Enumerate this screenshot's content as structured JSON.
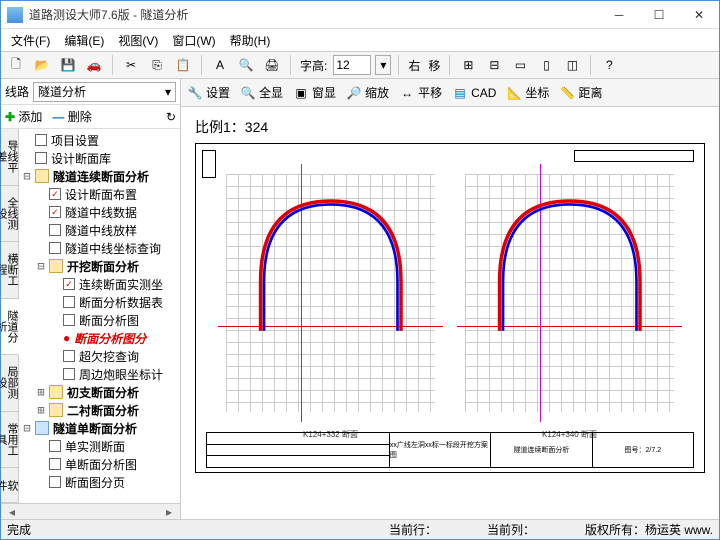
{
  "title": "道路测设大师7.6版 - 隧道分析",
  "menu": {
    "file": "文件(F)",
    "edit": "编辑(E)",
    "view": "视图(V)",
    "window": "窗口(W)",
    "help": "帮助(H)"
  },
  "tb1": {
    "fh_label": "字高:",
    "fh_value": "12",
    "right": "右",
    "move": "移"
  },
  "route": {
    "label": "线路",
    "value": "隧道分析"
  },
  "ops": {
    "add": "添加",
    "del": "删除"
  },
  "vtabs": [
    "导线平差",
    "全线测设",
    "横断工程",
    "隧道分析",
    "局部测设",
    "常用工具",
    "软件"
  ],
  "tree": {
    "n0": "项目设置",
    "n1": "设计断面库",
    "g0": "隧道连续断面分析",
    "g0c0": "设计断面布置",
    "g0c1": "隧道中线数据",
    "g0c2": "隧道中线放样",
    "g0c3": "隧道中线坐标查询",
    "g1": "开挖断面分析",
    "g1c0": "连续断面实测坐",
    "g1c1": "断面分析数据表",
    "g1c2": "断面分析图",
    "g1c3": "断面分析图分",
    "g1c4": "超欠挖查询",
    "g1c5": "周边炮眼坐标计",
    "g2": "初支断面分析",
    "g3": "二衬断面分析",
    "g4": "隧道单断面分析",
    "g4c0": "单实测断面",
    "g4c1": "单断面分析图",
    "g4c2": "断面图分页"
  },
  "tb2": {
    "set": "设置",
    "all": "全显",
    "win": "窗显",
    "zoom": "缩放",
    "pan": "平移",
    "cad": "CAD",
    "coord": "坐标",
    "dist": "距离"
  },
  "canvas": {
    "scale": "比例1：324",
    "cap1": "K124+332 断面",
    "cap2": "K124+340 断面",
    "tb_a": "xx广线左洞xx标一标段开挖方案图",
    "tb_b": "隧道连续断面分析",
    "tb_c": "图号：2/7.2"
  },
  "status": {
    "done": "完成",
    "row": "当前行：",
    "col": "当前列：",
    "cp": "版权所有：杨运英 www."
  }
}
